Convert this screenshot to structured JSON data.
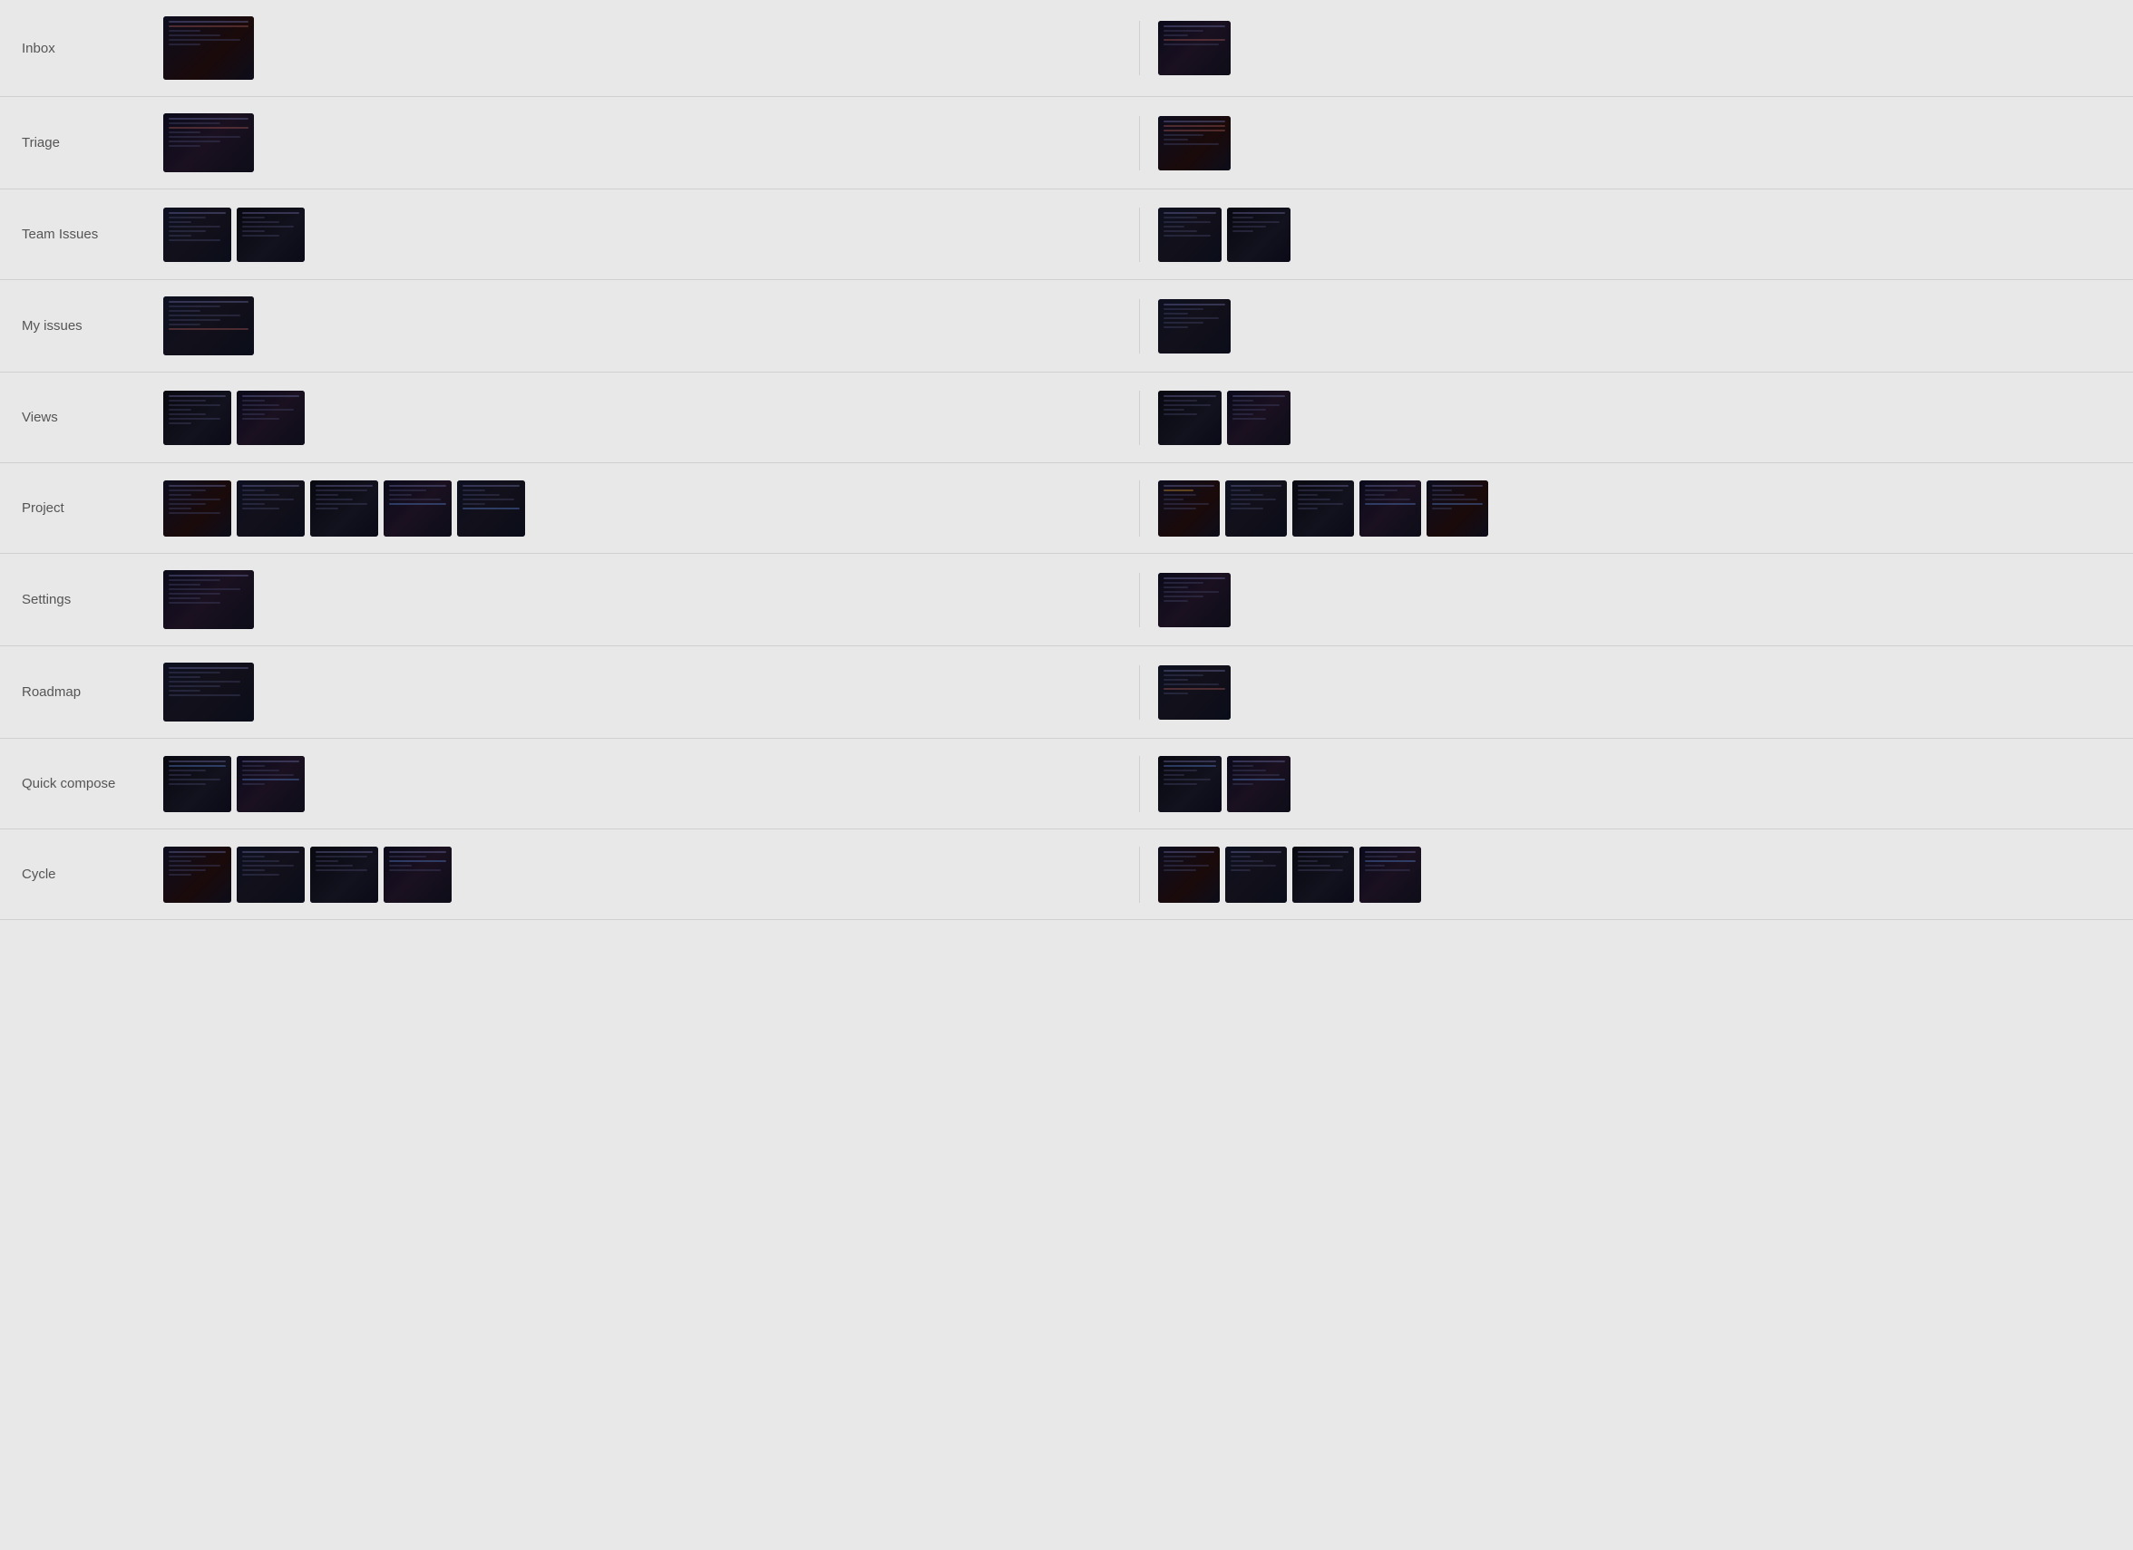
{
  "rows": [
    {
      "label": "Inbox",
      "left_thumbs": [
        {
          "w": 100,
          "h": 70,
          "variant": "v1",
          "lines": [
            "bright",
            "accent",
            "short",
            "medium",
            "long",
            "short"
          ]
        }
      ],
      "right_thumbs": [
        {
          "w": 80,
          "h": 60,
          "variant": "v2",
          "lines": [
            "bright",
            "medium",
            "short",
            "accent",
            "long"
          ]
        }
      ]
    },
    {
      "label": "Triage",
      "left_thumbs": [
        {
          "w": 100,
          "h": 65,
          "variant": "v2",
          "lines": [
            "bright",
            "medium",
            "accent",
            "short",
            "long",
            "medium",
            "short"
          ]
        }
      ],
      "right_thumbs": [
        {
          "w": 80,
          "h": 60,
          "variant": "v1",
          "lines": [
            "bright",
            "accent",
            "accent",
            "medium",
            "short",
            "long"
          ]
        }
      ]
    },
    {
      "label": "Team Issues",
      "left_thumbs": [
        {
          "w": 75,
          "h": 60,
          "variant": "v3",
          "lines": [
            "bright",
            "medium",
            "short",
            "long",
            "medium",
            "short",
            "long"
          ]
        },
        {
          "w": 75,
          "h": 60,
          "variant": "v4",
          "lines": [
            "bright",
            "short",
            "medium",
            "long",
            "short",
            "medium"
          ]
        }
      ],
      "right_thumbs": [
        {
          "w": 70,
          "h": 60,
          "variant": "v3",
          "lines": [
            "bright",
            "medium",
            "long",
            "short",
            "medium",
            "long"
          ]
        },
        {
          "w": 70,
          "h": 60,
          "variant": "v4",
          "lines": [
            "bright",
            "short",
            "long",
            "medium",
            "short"
          ]
        }
      ]
    },
    {
      "label": "My issues",
      "left_thumbs": [
        {
          "w": 100,
          "h": 65,
          "variant": "v3",
          "lines": [
            "bright",
            "medium",
            "short",
            "long",
            "medium",
            "short",
            "accent"
          ]
        }
      ],
      "right_thumbs": [
        {
          "w": 80,
          "h": 60,
          "variant": "v3",
          "lines": [
            "bright",
            "medium",
            "short",
            "long",
            "medium",
            "short"
          ]
        }
      ]
    },
    {
      "label": "Views",
      "left_thumbs": [
        {
          "w": 75,
          "h": 60,
          "variant": "v4",
          "lines": [
            "bright",
            "medium",
            "long",
            "short",
            "medium",
            "long",
            "short"
          ]
        },
        {
          "w": 75,
          "h": 60,
          "variant": "v2",
          "lines": [
            "bright",
            "short",
            "medium",
            "long",
            "short",
            "medium"
          ]
        }
      ],
      "right_thumbs": [
        {
          "w": 70,
          "h": 60,
          "variant": "v4",
          "lines": [
            "bright",
            "medium",
            "long",
            "short",
            "medium"
          ]
        },
        {
          "w": 70,
          "h": 60,
          "variant": "v2",
          "lines": [
            "bright",
            "short",
            "long",
            "medium",
            "short",
            "medium"
          ]
        }
      ]
    },
    {
      "label": "Project",
      "left_thumbs": [
        {
          "w": 75,
          "h": 62,
          "variant": "v1",
          "lines": [
            "bright",
            "medium",
            "short",
            "long",
            "medium",
            "short",
            "long"
          ]
        },
        {
          "w": 75,
          "h": 62,
          "variant": "v3",
          "lines": [
            "bright",
            "short",
            "medium",
            "long",
            "short",
            "medium"
          ]
        },
        {
          "w": 75,
          "h": 62,
          "variant": "v4",
          "lines": [
            "bright",
            "long",
            "short",
            "medium",
            "long",
            "short"
          ]
        },
        {
          "w": 75,
          "h": 62,
          "variant": "v2",
          "lines": [
            "bright",
            "medium",
            "short",
            "long",
            "accent-blue"
          ]
        },
        {
          "w": 75,
          "h": 62,
          "variant": "v3",
          "lines": [
            "bright",
            "short",
            "medium",
            "long",
            "short",
            "accent-blue"
          ]
        }
      ],
      "right_thumbs": [
        {
          "w": 68,
          "h": 62,
          "variant": "v1",
          "lines": [
            "bright",
            "accent-orange",
            "medium",
            "short",
            "long",
            "medium"
          ]
        },
        {
          "w": 68,
          "h": 62,
          "variant": "v3",
          "lines": [
            "bright",
            "short",
            "medium",
            "long",
            "short",
            "medium"
          ]
        },
        {
          "w": 68,
          "h": 62,
          "variant": "v4",
          "lines": [
            "bright",
            "long",
            "short",
            "medium",
            "long",
            "short"
          ]
        },
        {
          "w": 68,
          "h": 62,
          "variant": "v2",
          "lines": [
            "bright",
            "medium",
            "short",
            "long",
            "accent-blue"
          ]
        },
        {
          "w": 68,
          "h": 62,
          "variant": "v1",
          "lines": [
            "bright",
            "short",
            "medium",
            "long",
            "accent-blue",
            "short"
          ]
        }
      ]
    },
    {
      "label": "Settings",
      "left_thumbs": [
        {
          "w": 100,
          "h": 65,
          "variant": "v2",
          "lines": [
            "bright",
            "medium",
            "short",
            "long",
            "medium",
            "short",
            "medium"
          ]
        }
      ],
      "right_thumbs": [
        {
          "w": 80,
          "h": 60,
          "variant": "v2",
          "lines": [
            "bright",
            "medium",
            "short",
            "long",
            "medium",
            "short"
          ]
        }
      ]
    },
    {
      "label": "Roadmap",
      "left_thumbs": [
        {
          "w": 100,
          "h": 65,
          "variant": "v3",
          "lines": [
            "bright",
            "medium",
            "short",
            "long",
            "medium",
            "short",
            "long"
          ]
        }
      ],
      "right_thumbs": [
        {
          "w": 80,
          "h": 60,
          "variant": "v3",
          "lines": [
            "bright",
            "medium",
            "short",
            "long",
            "accent",
            "short"
          ]
        }
      ]
    },
    {
      "label": "Quick compose",
      "left_thumbs": [
        {
          "w": 75,
          "h": 62,
          "variant": "v4",
          "lines": [
            "bright",
            "accent-blue",
            "medium",
            "short",
            "long",
            "medium"
          ]
        },
        {
          "w": 75,
          "h": 62,
          "variant": "v2",
          "lines": [
            "bright",
            "short",
            "medium",
            "long",
            "accent-blue",
            "short"
          ]
        }
      ],
      "right_thumbs": [
        {
          "w": 70,
          "h": 62,
          "variant": "v4",
          "lines": [
            "bright",
            "accent-blue",
            "medium",
            "short",
            "long",
            "medium"
          ]
        },
        {
          "w": 70,
          "h": 62,
          "variant": "v2",
          "lines": [
            "bright",
            "short",
            "medium",
            "long",
            "accent-blue",
            "short"
          ]
        }
      ]
    },
    {
      "label": "Cycle",
      "left_thumbs": [
        {
          "w": 75,
          "h": 62,
          "variant": "v1",
          "lines": [
            "bright",
            "medium",
            "short",
            "long",
            "medium",
            "short"
          ]
        },
        {
          "w": 75,
          "h": 62,
          "variant": "v3",
          "lines": [
            "bright",
            "short",
            "medium",
            "long",
            "short",
            "medium"
          ]
        },
        {
          "w": 75,
          "h": 62,
          "variant": "v4",
          "lines": [
            "bright",
            "long",
            "short",
            "medium",
            "long"
          ]
        },
        {
          "w": 75,
          "h": 62,
          "variant": "v2",
          "lines": [
            "bright",
            "medium",
            "accent-blue",
            "short",
            "long"
          ]
        }
      ],
      "right_thumbs": [
        {
          "w": 68,
          "h": 62,
          "variant": "v1",
          "lines": [
            "bright",
            "medium",
            "short",
            "long",
            "medium"
          ]
        },
        {
          "w": 68,
          "h": 62,
          "variant": "v3",
          "lines": [
            "bright",
            "short",
            "medium",
            "long",
            "short"
          ]
        },
        {
          "w": 68,
          "h": 62,
          "variant": "v4",
          "lines": [
            "bright",
            "long",
            "short",
            "medium",
            "long"
          ]
        },
        {
          "w": 68,
          "h": 62,
          "variant": "v2",
          "lines": [
            "bright",
            "medium",
            "accent-blue",
            "short",
            "long"
          ]
        }
      ]
    }
  ]
}
